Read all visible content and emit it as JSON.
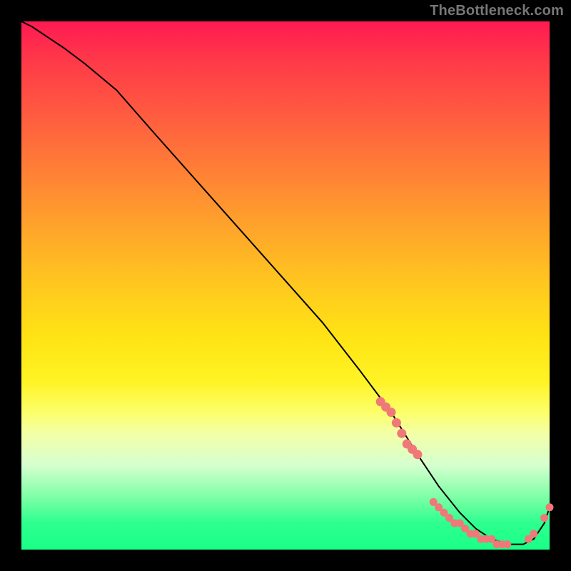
{
  "watermark": "TheBottleneck.com",
  "colors": {
    "marker": "#f07878",
    "curve": "#000000"
  },
  "chart_data": {
    "type": "line",
    "title": "",
    "xlabel": "",
    "ylabel": "",
    "xlim": [
      0,
      100
    ],
    "ylim": [
      0,
      100
    ],
    "grid": false,
    "legend": false,
    "description": "Bottleneck-style curve on red→yellow→green vertical gradient. Curve starts near top-left, descends roughly linearly to a flat minimum near the bottom around x≈80-90, then rises slightly at the right edge. Salmon markers cluster on the descending segment near x≈68-75, along the valley floor x≈78-92, and at the tail uptick x≈96-100.",
    "series": [
      {
        "name": "curve",
        "x": [
          0,
          2,
          5,
          8,
          12,
          18,
          25,
          33,
          41,
          49,
          57,
          64,
          70,
          75,
          79,
          83,
          86,
          89,
          92,
          95,
          97,
          99,
          100
        ],
        "y": [
          100,
          99,
          97,
          95,
          92,
          87,
          79,
          70,
          61,
          52,
          43,
          34,
          26,
          18,
          12,
          7,
          4,
          2,
          1,
          1,
          2,
          5,
          8
        ]
      }
    ],
    "markers": {
      "upper_cluster": {
        "x": [
          68,
          69,
          70,
          71,
          72,
          73,
          74,
          75
        ],
        "y": [
          28,
          27,
          26,
          24,
          22,
          20,
          19,
          18
        ]
      },
      "valley_cluster": {
        "x": [
          78,
          79,
          80,
          81,
          82,
          83,
          84,
          85,
          86,
          87,
          88,
          89,
          90,
          91,
          92
        ],
        "y": [
          9,
          8,
          7,
          6,
          5,
          5,
          4,
          3,
          3,
          2,
          2,
          2,
          1,
          1,
          1
        ]
      },
      "tail_cluster": {
        "x": [
          96,
          97,
          99,
          100
        ],
        "y": [
          2,
          3,
          6,
          8
        ]
      }
    }
  }
}
